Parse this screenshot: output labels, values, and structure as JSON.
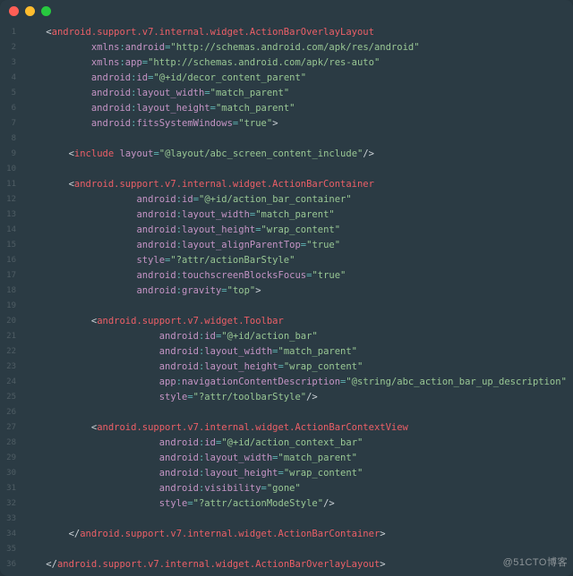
{
  "window": {
    "dots": [
      "close",
      "minimize",
      "zoom"
    ]
  },
  "watermark": "@51CTO博客",
  "code": [
    {
      "ind": 1,
      "kind": "open-start",
      "tag": "android.support.v7.internal.widget.ActionBarOverlayLayout"
    },
    {
      "ind": 3,
      "kind": "attr",
      "ns": "xmlns",
      "attr": "android",
      "val": "http://schemas.android.com/apk/res/android"
    },
    {
      "ind": 3,
      "kind": "attr",
      "ns": "xmlns",
      "attr": "app",
      "val": "http://schemas.android.com/apk/res-auto"
    },
    {
      "ind": 3,
      "kind": "attr",
      "ns": "android",
      "attr": "id",
      "val": "@+id/decor_content_parent"
    },
    {
      "ind": 3,
      "kind": "attr",
      "ns": "android",
      "attr": "layout_width",
      "val": "match_parent"
    },
    {
      "ind": 3,
      "kind": "attr",
      "ns": "android",
      "attr": "layout_height",
      "val": "match_parent"
    },
    {
      "ind": 3,
      "kind": "attr-close",
      "ns": "android",
      "attr": "fitsSystemWindows",
      "val": "true"
    },
    {
      "ind": 0,
      "kind": "blank"
    },
    {
      "ind": 2,
      "kind": "self-attr",
      "tag": "include",
      "ns": "",
      "attr": "layout",
      "val": "@layout/abc_screen_content_include"
    },
    {
      "ind": 0,
      "kind": "blank"
    },
    {
      "ind": 2,
      "kind": "open-start",
      "tag": "android.support.v7.internal.widget.ActionBarContainer"
    },
    {
      "ind": 5,
      "kind": "attr",
      "ns": "android",
      "attr": "id",
      "val": "@+id/action_bar_container"
    },
    {
      "ind": 5,
      "kind": "attr",
      "ns": "android",
      "attr": "layout_width",
      "val": "match_parent"
    },
    {
      "ind": 5,
      "kind": "attr",
      "ns": "android",
      "attr": "layout_height",
      "val": "wrap_content"
    },
    {
      "ind": 5,
      "kind": "attr",
      "ns": "android",
      "attr": "layout_alignParentTop",
      "val": "true"
    },
    {
      "ind": 5,
      "kind": "attr",
      "ns": "",
      "attr": "style",
      "val": "?attr/actionBarStyle"
    },
    {
      "ind": 5,
      "kind": "attr",
      "ns": "android",
      "attr": "touchscreenBlocksFocus",
      "val": "true"
    },
    {
      "ind": 5,
      "kind": "attr-close",
      "ns": "android",
      "attr": "gravity",
      "val": "top"
    },
    {
      "ind": 0,
      "kind": "blank"
    },
    {
      "ind": 3,
      "kind": "open-start",
      "tag": "android.support.v7.widget.Toolbar"
    },
    {
      "ind": 6,
      "kind": "attr",
      "ns": "android",
      "attr": "id",
      "val": "@+id/action_bar"
    },
    {
      "ind": 6,
      "kind": "attr",
      "ns": "android",
      "attr": "layout_width",
      "val": "match_parent"
    },
    {
      "ind": 6,
      "kind": "attr",
      "ns": "android",
      "attr": "layout_height",
      "val": "wrap_content"
    },
    {
      "ind": 6,
      "kind": "attr",
      "ns": "app",
      "attr": "navigationContentDescription",
      "val": "@string/abc_action_bar_up_description"
    },
    {
      "ind": 6,
      "kind": "attr-self",
      "ns": "",
      "attr": "style",
      "val": "?attr/toolbarStyle"
    },
    {
      "ind": 0,
      "kind": "blank"
    },
    {
      "ind": 3,
      "kind": "open-start",
      "tag": "android.support.v7.internal.widget.ActionBarContextView"
    },
    {
      "ind": 6,
      "kind": "attr",
      "ns": "android",
      "attr": "id",
      "val": "@+id/action_context_bar"
    },
    {
      "ind": 6,
      "kind": "attr",
      "ns": "android",
      "attr": "layout_width",
      "val": "match_parent"
    },
    {
      "ind": 6,
      "kind": "attr",
      "ns": "android",
      "attr": "layout_height",
      "val": "wrap_content"
    },
    {
      "ind": 6,
      "kind": "attr",
      "ns": "android",
      "attr": "visibility",
      "val": "gone"
    },
    {
      "ind": 6,
      "kind": "attr-self",
      "ns": "",
      "attr": "style",
      "val": "?attr/actionModeStyle"
    },
    {
      "ind": 0,
      "kind": "blank"
    },
    {
      "ind": 2,
      "kind": "close",
      "tag": "android.support.v7.internal.widget.ActionBarContainer"
    },
    {
      "ind": 0,
      "kind": "blank"
    },
    {
      "ind": 1,
      "kind": "close",
      "tag": "android.support.v7.internal.widget.ActionBarOverlayLayout"
    }
  ]
}
